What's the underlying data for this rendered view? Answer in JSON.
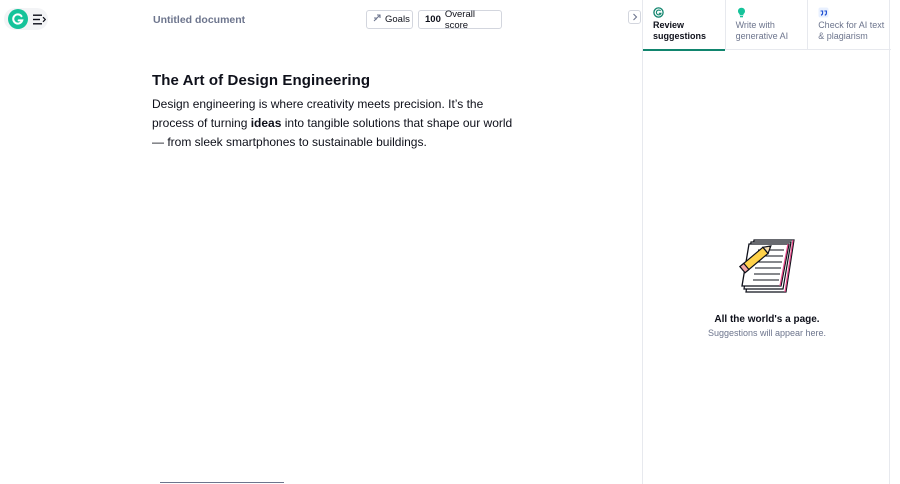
{
  "app": {
    "colors": {
      "brand": "#15c39a",
      "accent": "#11856e",
      "muted": "#6d758d"
    }
  },
  "header": {
    "doc_title": "Untitled document",
    "goals_label": "Goals",
    "score_value": "100",
    "score_label": "Overall score"
  },
  "document": {
    "heading": "The Art of Design Engineering",
    "para_part1": "Design engineering is where creativity meets precision. It’s the process of turning ",
    "para_bold": "ideas",
    "para_part2": " into tangible solutions that shape our world — from sleek smartphones to sustainable buildings."
  },
  "panel": {
    "tabs": [
      {
        "label": "Review suggestions",
        "icon": "grammarly-icon",
        "active": true
      },
      {
        "label": "Write with generative AI",
        "icon": "lightbulb-icon",
        "active": false
      },
      {
        "label": "Check for AI text & plagiarism",
        "icon": "quote-icon",
        "active": false
      }
    ],
    "empty_title": "All the world's a page.",
    "empty_subtitle": "Suggestions will appear here."
  }
}
